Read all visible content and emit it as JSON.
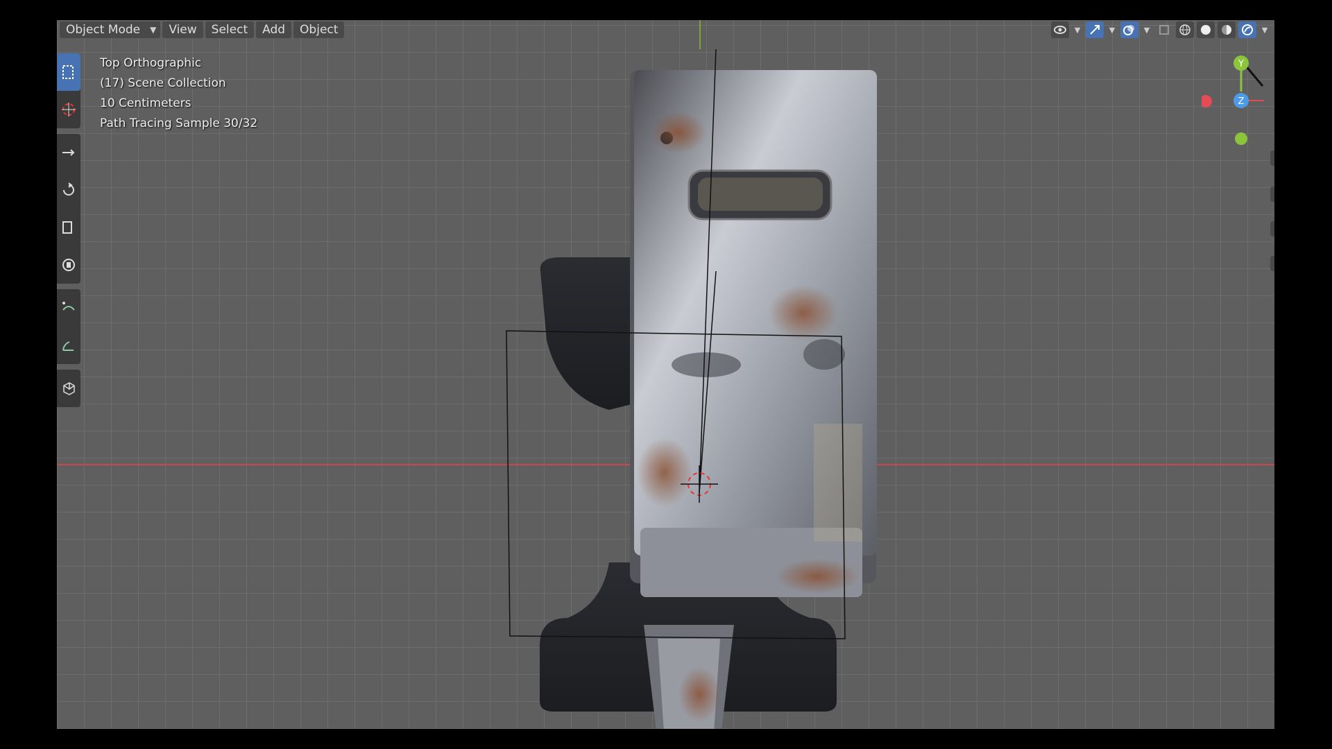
{
  "header": {
    "mode": "Object Mode",
    "menu": [
      "View",
      "Select",
      "Add",
      "Object"
    ]
  },
  "overlay": {
    "view": "Top Orthographic",
    "collection": "(17) Scene Collection",
    "scale": "10 Centimeters",
    "render": "Path Tracing Sample 30/32"
  },
  "gizmo": {
    "y_label": "Y",
    "z_label": "Z",
    "colors": {
      "x": "#e34c57",
      "y": "#8cc43c",
      "z": "#4d9be8"
    }
  },
  "shading": {
    "active": "rendered"
  },
  "icons": [
    "visibility-icon",
    "gizmo-icon",
    "overlay-icon",
    "xray-icon",
    "wireframe-icon",
    "solid-icon",
    "material-icon",
    "rendered-icon"
  ],
  "colors": {
    "accent": "#4772b3",
    "axis_x": "#c8474f",
    "axis_y": "#7ea33a"
  }
}
